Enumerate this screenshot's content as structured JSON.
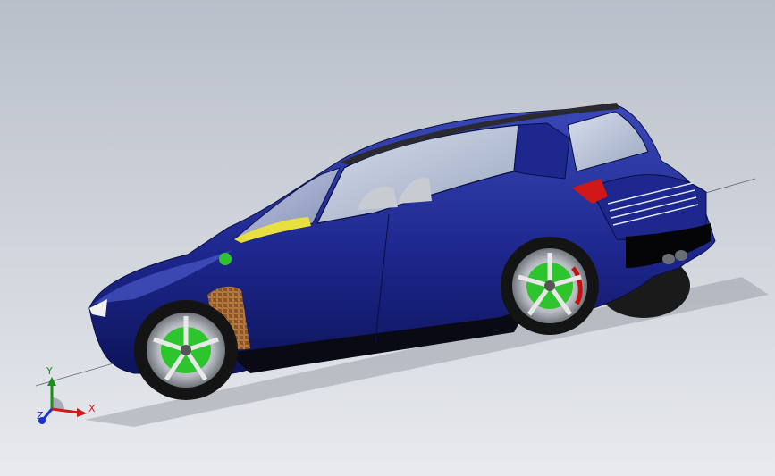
{
  "scene": {
    "model": "car-assembly",
    "body_color": "#1f2a8f",
    "background_top": "#b9bfca",
    "background_bottom": "#e8eaee"
  },
  "triad": {
    "x_label": "X",
    "y_label": "Y",
    "z_label": "Z",
    "x_color": "#d01818",
    "y_color": "#1a8f1a",
    "z_color": "#1b32c8"
  }
}
